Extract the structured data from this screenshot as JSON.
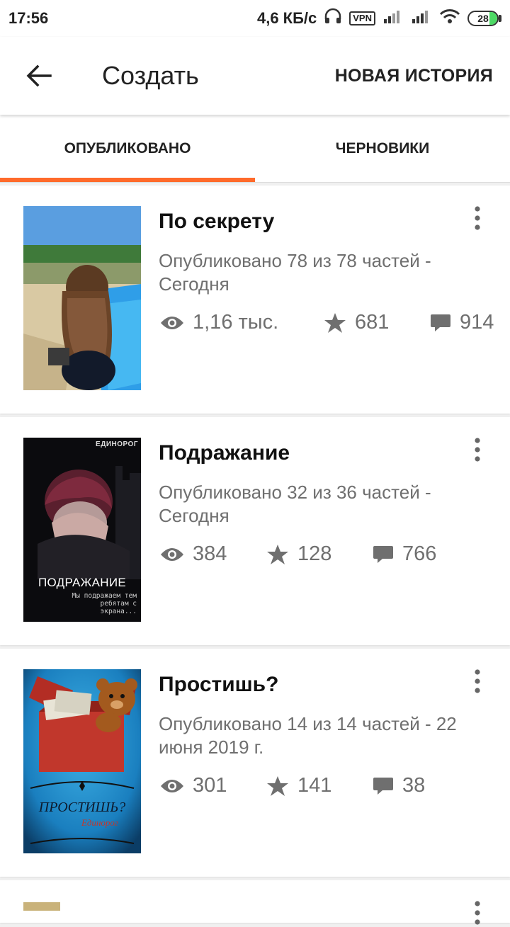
{
  "status_bar": {
    "time": "17:56",
    "speed": "4,6 КБ/с",
    "vpn": "VPN",
    "battery": "28",
    "battery_level": 0.28
  },
  "app_bar": {
    "title": "Создать",
    "action": "НОВАЯ ИСТОРИЯ"
  },
  "tabs": [
    {
      "label": "ОПУБЛИКОВАНО",
      "active": true
    },
    {
      "label": "ЧЕРНОВИКИ",
      "active": false
    }
  ],
  "accent_color": "#ff6a2b",
  "stories": [
    {
      "title": "По секрету",
      "meta": "Опубликовано 78 из 78 частей - Сегодня",
      "views": "1,16 тыс.",
      "votes": "681",
      "comments": "914"
    },
    {
      "title": "Подражание",
      "meta": "Опубликовано 32 из 36 частей - Сегодня",
      "views": "384",
      "votes": "128",
      "comments": "766",
      "cover": {
        "top": "ЕДИНОРОГ",
        "title": "ПОДРАЖАНИЕ",
        "subtitle": "Мы подражаем тем ребятам с экрана..."
      }
    },
    {
      "title": "Простишь?",
      "meta": "Опубликовано 14 из 14 частей - 22 июня 2019 г.",
      "views": "301",
      "votes": "141",
      "comments": "38",
      "cover": {
        "title": "ПРОСТИШЬ?",
        "author": "Единорог"
      }
    }
  ],
  "icons": {
    "back": "arrow-left-icon",
    "views": "eye-icon",
    "votes": "star-icon",
    "comments": "comment-icon",
    "more": "more-vertical-icon"
  }
}
